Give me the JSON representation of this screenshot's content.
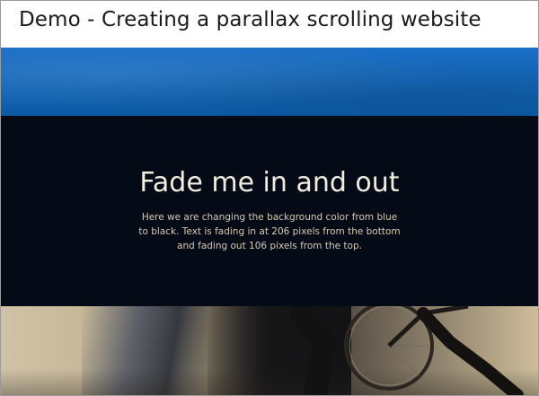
{
  "header": {
    "title": "Demo - Creating a parallax scrolling website"
  },
  "section": {
    "heading": "Fade me in and out",
    "text": "Here we are changing the background color from blue to black. Text is fading in at 206 pixels from the bottom and fading out 106 pixels from the top."
  },
  "colors": {
    "blue_band": "#1466b8",
    "dark_background": "#050b16",
    "heading_text": "#f2ebe0",
    "body_text": "#d8c9b2"
  }
}
